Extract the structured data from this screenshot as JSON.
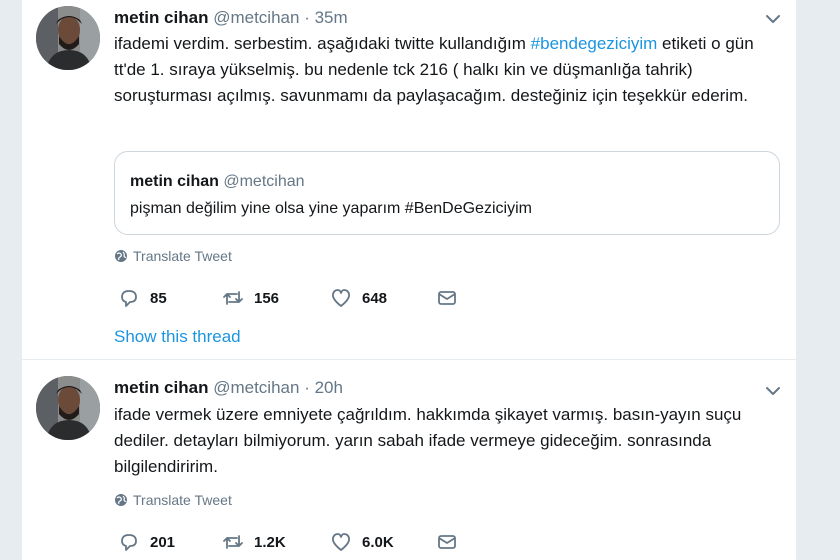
{
  "tweets": [
    {
      "name": "metin cihan",
      "handle": "@metcihan",
      "separator": "·",
      "time": "35m",
      "text_before": "ifademi verdim. serbestim. aşağıdaki twitte kullandığım ",
      "hashtag": "#bendegeziciyim",
      "text_after": " etiketi o gün tt'de 1. sıraya yükselmiş. bu nedenle tck 216 ( halkı kin ve düşmanlığa tahrik) soruşturması açılmış. savunmamı da paylaşacağım. desteğiniz için teşekkür ederim.",
      "quote": {
        "name": "metin cihan",
        "handle": "@metcihan",
        "text": "pişman değilim yine olsa yine yaparım #BenDeGeziciyim"
      },
      "translate_label": "Translate Tweet",
      "replies": "85",
      "retweets": "156",
      "likes": "648",
      "show_thread": "Show this thread"
    },
    {
      "name": "metin cihan",
      "handle": "@metcihan",
      "separator": "·",
      "time": "20h",
      "text": "ifade vermek üzere emniyete çağrıldım. hakkımda şikayet varmış. basın-yayın suçu dediler. detayları bilmiyorum. yarın sabah ifade vermeye gideceğim. sonrasında bilgilendiririm.",
      "translate_label": "Translate Tweet",
      "replies": "201",
      "retweets": "1.2K",
      "likes": "6.0K"
    }
  ],
  "icons": {
    "reply": "reply-icon",
    "retweet": "retweet-icon",
    "like": "heart-icon",
    "message": "envelope-icon",
    "translate": "globe-icon",
    "menu": "chevron-down-icon"
  },
  "colors": {
    "link": "#1b95e0",
    "secondary_text": "#657786",
    "background": "#e6ecf0"
  }
}
